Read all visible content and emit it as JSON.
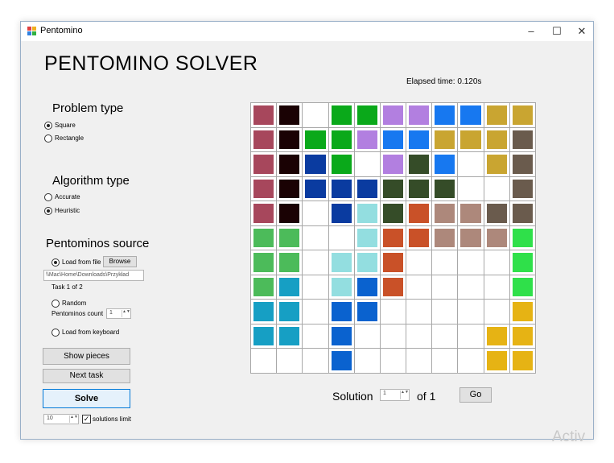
{
  "window": {
    "title": "Pentomino"
  },
  "titlebar": {
    "minimize": "–",
    "maximize": "☐",
    "close": "✕"
  },
  "heading": "PENTOMINO SOLVER",
  "elapsed": "Elapsed time: 0.120s",
  "problem_type": {
    "title": "Problem type",
    "options": [
      {
        "label": "Square",
        "selected": true
      },
      {
        "label": "Rectangle",
        "selected": false
      }
    ]
  },
  "algorithm_type": {
    "title": "Algorithm type",
    "options": [
      {
        "label": "Accurate",
        "selected": false
      },
      {
        "label": "Heuristic",
        "selected": true
      }
    ]
  },
  "source": {
    "title": "Pentominos source",
    "load_file_label": "Load from file",
    "browse_label": "Browse",
    "path_value": "\\\\Mac\\Home\\Downloads\\Przykład",
    "task_label": "Task 1 of 2",
    "random_label": "Random",
    "count_label": "Pentominos count",
    "count_value": "1",
    "keyboard_label": "Load from keyboard"
  },
  "buttons": {
    "show_pieces": "Show pieces",
    "next_task": "Next task",
    "solve": "Solve",
    "go": "Go"
  },
  "limit": {
    "value": "10",
    "label": "solutions limit",
    "checked": "✓"
  },
  "solution": {
    "label": "Solution",
    "value": "1",
    "of": "of 1"
  },
  "spin_arrows": "▲▼",
  "watermark": "Activ",
  "palette": {
    "a": "#a7475c",
    "b": "#1a0204",
    "c": "#0aa91a",
    "d": "#b27fe0",
    "e": "#1778f0",
    "f": "#c9a531",
    "g": "#6a5b4d",
    "h": "#0a3ba0",
    "i": "#354c28",
    "j": "#93dee0",
    "k": "#c95128",
    "l": "#ad887b",
    "m": "#4cbb5a",
    "n": "#2fe04a",
    "o": "#169fc4",
    "p": "#0a62cf",
    "q": "#e6b314"
  },
  "board": [
    "ab.ccddeeff",
    "abccdeefffg",
    "abhc.die.fg",
    "abhhhiii..g",
    "ab.hjikllgg",
    "mm..jkkllln",
    "mm.jjk....n",
    "mo.jpk....n",
    "oo.pp.....q",
    "oo.p.....qq",
    "...p.....qq"
  ]
}
